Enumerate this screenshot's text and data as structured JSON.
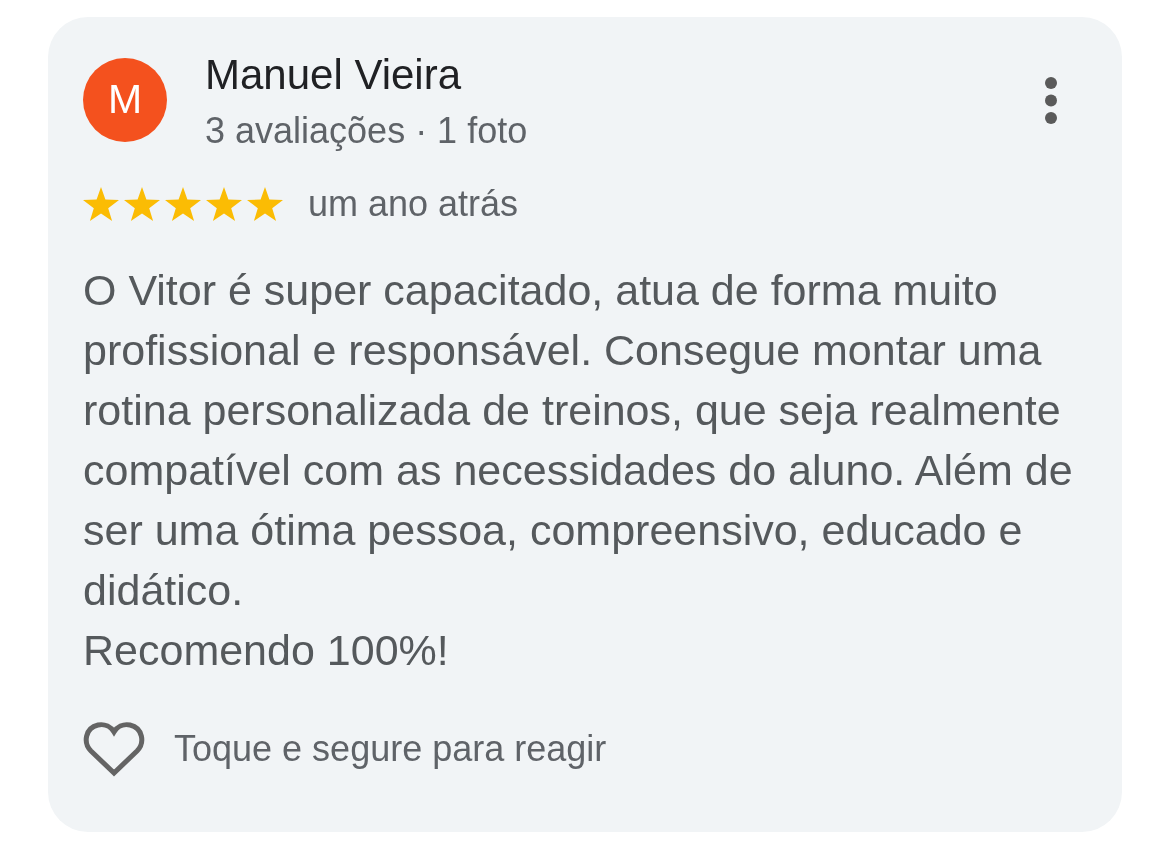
{
  "review": {
    "author": {
      "initial": "M",
      "name": "Manuel Vieira",
      "meta": "3 avaliações · 1 foto"
    },
    "stars": 5,
    "time": "um ano atrás",
    "text": "O Vitor é super capacitado, atua de forma muito profissional e responsável. Consegue montar uma rotina personalizada de treinos, que seja realmente compatível com as necessidades do aluno. Além de ser uma ótima pessoa, compreensivo, educado e didático.\nRecomendo 100%!",
    "react_hint": "Toque e segure para reagir"
  }
}
